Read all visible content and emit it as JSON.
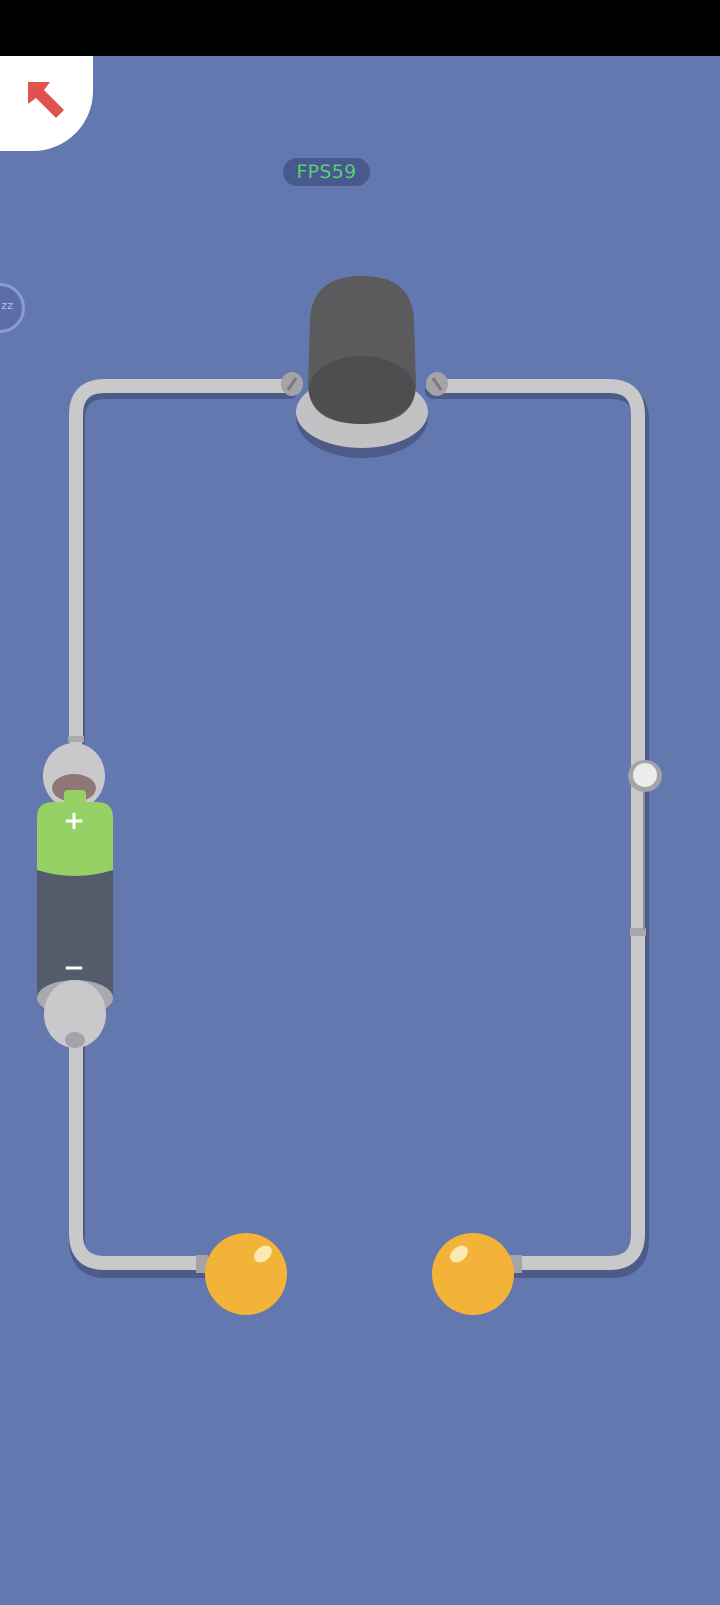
{
  "hud": {
    "fps_label": "FPS59",
    "side_button_text": "zz"
  },
  "battery": {
    "plus_symbol": "+",
    "minus_symbol": "−"
  },
  "icons": {
    "back": "arrow-up-left-icon"
  },
  "colors": {
    "background": "#6478b0",
    "wire": "#c9c9cb",
    "wire_shadow": "#4c5a86",
    "battery_positive": "#96d165",
    "battery_body": "#545b6a",
    "ball": "#f3b339",
    "bulb_socket": "#5b5b5d",
    "fps_text": "#58d46e",
    "back_arrow": "#e0524d"
  }
}
